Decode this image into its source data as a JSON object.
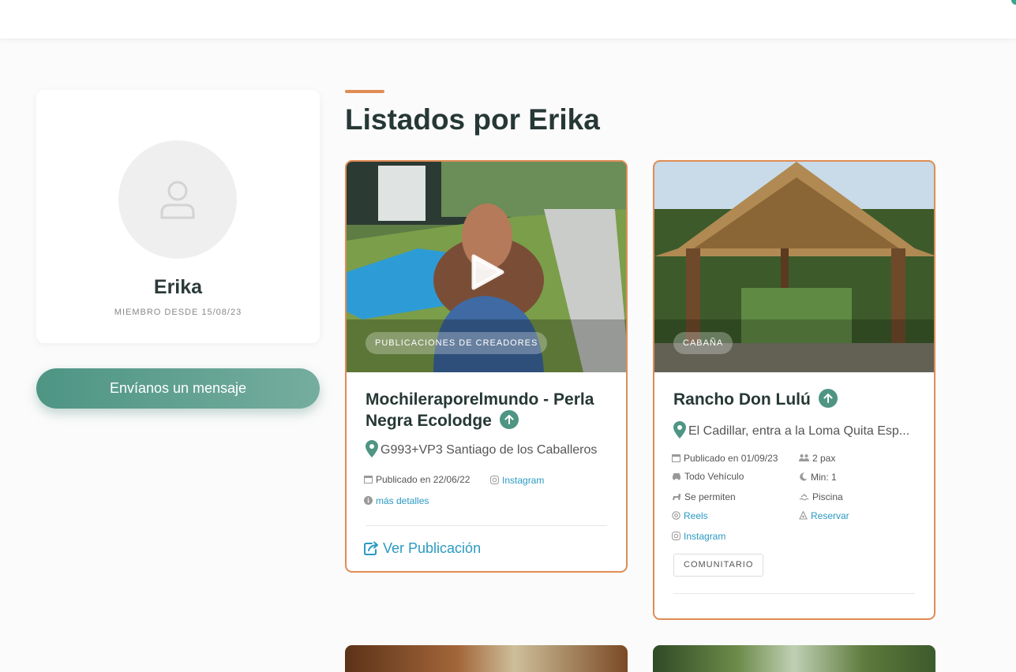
{
  "profile": {
    "name": "Erika",
    "member_since": "MIEMBRO DESDE 15/08/23",
    "message_button": "Envíanos un mensaje"
  },
  "section_title": "Listados por Erika",
  "listings": [
    {
      "badge": "PUBLICACIONES DE CREADORES",
      "title": "Mochileraporelmundo - Perla Negra Ecolodge",
      "location": "G993+VP3 Santiago de los Caballeros",
      "published": "Publicado en 22/06/22",
      "instagram": "Instagram",
      "more_details": "más detalles",
      "view_post": "Ver Publicación"
    },
    {
      "badge": "CABAÑA",
      "title": "Rancho Don Lulú",
      "location": "El Cadillar, entra a la Loma Quita Esp...",
      "published": "Publicado en 01/09/23",
      "pax": "2 pax",
      "vehicle": "Todo Vehículo",
      "min": "Min: 1",
      "pets": "Se permiten",
      "pool": "Piscina",
      "reels": "Reels",
      "reserve": "Reservar",
      "instagram": "Instagram",
      "tag": "COMUNITARIO"
    }
  ],
  "colors": {
    "accent": "#e08c55",
    "primary": "#4e9584",
    "link": "#2b9ac2",
    "title": "#263835"
  },
  "icons": [
    "user-icon",
    "play-icon",
    "up-arrow-icon",
    "map-pin-icon",
    "calendar-icon",
    "instagram-icon",
    "info-icon",
    "share-icon",
    "people-icon",
    "car-icon",
    "moon-icon",
    "pet-icon",
    "pool-icon",
    "at-icon",
    "reserve-icon"
  ]
}
